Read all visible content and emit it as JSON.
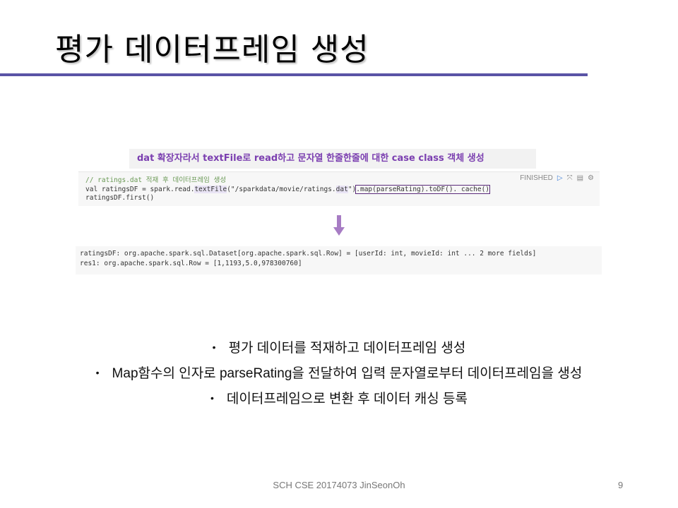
{
  "slide": {
    "title": "평가 데이터프레임 생성",
    "accent_color": "#5a54a6"
  },
  "callout": {
    "text": "dat 확장자라서 textFile로 read하고 문자열 한줄한줄에 대한 case class 객체 생성",
    "color": "#7b3fb0"
  },
  "code_cell": {
    "comment": "// ratings.dat 적재 후 데이터프레임 생성",
    "line2_a": "val ratingsDF = spark.read.",
    "line2_b": "textFile",
    "line2_c": "(\"/sparkdata/movie/ratings.",
    "line2_d": "dat",
    "line2_e": "\")",
    "line2_f": ".map(parseRating).toDF(). cache()",
    "line3": "ratingsDF.first()",
    "status": "FINISHED",
    "icons": [
      "run-icon",
      "expand-icon",
      "book-icon",
      "gear-icon"
    ]
  },
  "output": {
    "line1": "ratingsDF: org.apache.spark.sql.Dataset[org.apache.spark.sql.Row] = [userId: int, movieId: int ... 2 more fields]",
    "line2": "res1: org.apache.spark.sql.Row = [1,1193,5.0,978300760]"
  },
  "bullets": [
    "평가 데이터를 적재하고 데이터프레임 생성",
    "Map함수의 인자로 parseRating을 전달하여 입력 문자열로부터 데이터프레임을 생성",
    "데이터프레임으로 변환 후 데이터 캐싱 등록"
  ],
  "footer": {
    "text": "SCH CSE 20174073 JinSeonOh",
    "page": "9"
  }
}
